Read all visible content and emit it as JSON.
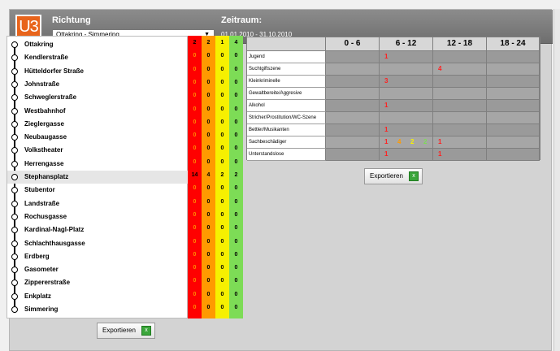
{
  "header": {
    "line_badge": "U3",
    "richtung_label": "Richtung",
    "route_value": "Ottakring - Simmering",
    "zeitraum_label": "Zeitraum:",
    "period_value": "01.01.2010 - 31.10.2010"
  },
  "stations": [
    {
      "name": "Ottakring",
      "counts": [
        "2",
        "2",
        "1",
        "4"
      ]
    },
    {
      "name": "Kendlerstraße",
      "counts": [
        "0",
        "0",
        "0",
        "0"
      ]
    },
    {
      "name": "Hütteldorfer Straße",
      "counts": [
        "0",
        "0",
        "0",
        "0"
      ]
    },
    {
      "name": "Johnstraße",
      "counts": [
        "0",
        "0",
        "0",
        "0"
      ]
    },
    {
      "name": "Schweglerstraße",
      "counts": [
        "0",
        "0",
        "0",
        "0"
      ]
    },
    {
      "name": "Westbahnhof",
      "counts": [
        "0",
        "0",
        "0",
        "0"
      ]
    },
    {
      "name": "Zieglergasse",
      "counts": [
        "0",
        "0",
        "0",
        "0"
      ]
    },
    {
      "name": "Neubaugasse",
      "counts": [
        "0",
        "0",
        "0",
        "0"
      ]
    },
    {
      "name": "Volkstheater",
      "counts": [
        "0",
        "0",
        "0",
        "0"
      ]
    },
    {
      "name": "Herrengasse",
      "counts": [
        "0",
        "0",
        "0",
        "0"
      ]
    },
    {
      "name": "Stephansplatz",
      "counts": [
        "14",
        "4",
        "2",
        "2"
      ],
      "selected": true
    },
    {
      "name": "Stubentor",
      "counts": [
        "0",
        "0",
        "0",
        "0"
      ]
    },
    {
      "name": "Landstraße",
      "counts": [
        "0",
        "0",
        "0",
        "0"
      ]
    },
    {
      "name": "Rochusgasse",
      "counts": [
        "0",
        "0",
        "0",
        "0"
      ]
    },
    {
      "name": "Kardinal-Nagl-Platz",
      "counts": [
        "0",
        "0",
        "0",
        "0"
      ]
    },
    {
      "name": "Schlachthausgasse",
      "counts": [
        "0",
        "0",
        "0",
        "0"
      ]
    },
    {
      "name": "Erdberg",
      "counts": [
        "0",
        "0",
        "0",
        "0"
      ]
    },
    {
      "name": "Gasometer",
      "counts": [
        "0",
        "0",
        "0",
        "0"
      ]
    },
    {
      "name": "Zippererstraße",
      "counts": [
        "0",
        "0",
        "0",
        "0"
      ]
    },
    {
      "name": "Enkplatz",
      "counts": [
        "0",
        "0",
        "0",
        "0"
      ]
    },
    {
      "name": "Simmering",
      "counts": [
        "0",
        "0",
        "0",
        "0"
      ]
    }
  ],
  "export_label": "Exportieren",
  "export_icon": "excel-icon",
  "matrix": {
    "columns": [
      "0 - 6",
      "6 - 12",
      "12 - 18",
      "18 - 24"
    ],
    "rows": [
      {
        "label": "Jugend",
        "cells": [
          [],
          [
            {
              "v": "1",
              "c": "#ff2020"
            }
          ],
          [],
          []
        ]
      },
      {
        "label": "Suchtgiftszene",
        "cells": [
          [],
          [],
          [
            {
              "v": "4",
              "c": "#ff2020"
            }
          ],
          []
        ]
      },
      {
        "label": "Kleinkriminelle",
        "cells": [
          [],
          [
            {
              "v": "3",
              "c": "#ff2020"
            }
          ],
          [],
          []
        ]
      },
      {
        "label": "Gewaltbereite/Aggresive",
        "cells": [
          [],
          [],
          [],
          []
        ]
      },
      {
        "label": "Alkohol",
        "cells": [
          [],
          [
            {
              "v": "1",
              "c": "#ff2020"
            }
          ],
          [],
          []
        ]
      },
      {
        "label": "Stricher/Prostitution/WC-Szene",
        "cells": [
          [],
          [],
          [],
          []
        ]
      },
      {
        "label": "Bettler/Musikanten",
        "cells": [
          [],
          [
            {
              "v": "1",
              "c": "#ff2020"
            }
          ],
          [],
          []
        ]
      },
      {
        "label": "Sachbeschädiger",
        "cells": [
          [],
          [
            {
              "v": "1",
              "c": "#ff2020"
            },
            {
              "v": "4",
              "c": "#ff9a00"
            },
            {
              "v": "2",
              "c": "#f6f000"
            },
            {
              "v": "2",
              "c": "#7ddc56"
            }
          ],
          [
            {
              "v": "1",
              "c": "#ff2020"
            }
          ],
          []
        ]
      },
      {
        "label": "Unterstandslose",
        "cells": [
          [],
          [
            {
              "v": "1",
              "c": "#ff2020"
            }
          ],
          [
            {
              "v": "1",
              "c": "#ff2020"
            }
          ],
          []
        ]
      }
    ]
  },
  "colors": {
    "accent": "#e8641b",
    "red": "#ff0000",
    "orange": "#ff9a00",
    "yellow": "#f6f000",
    "green": "#7ddc56",
    "header": "#7a7a7a"
  }
}
